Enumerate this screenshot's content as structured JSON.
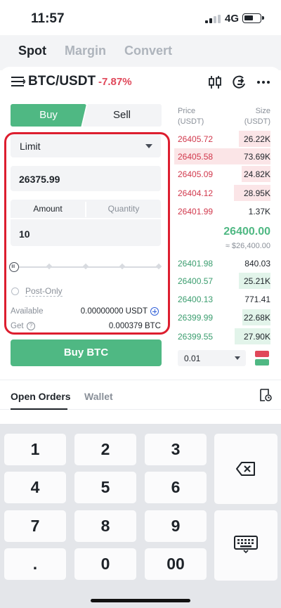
{
  "status": {
    "time": "11:57",
    "network": "4G"
  },
  "mode_tabs": [
    {
      "label": "Spot",
      "active": true
    },
    {
      "label": "Margin",
      "active": false
    },
    {
      "label": "Convert",
      "active": false
    }
  ],
  "pair": {
    "name": "BTC/USDT",
    "change": "-7.87%",
    "change_color": "#e0485a"
  },
  "form": {
    "buy_tab": "Buy",
    "sell_tab": "Sell",
    "order_type": "Limit",
    "price": "26375.99",
    "amount_tab": "Amount",
    "quantity_tab": "Quantity",
    "amount": "10",
    "slider_percent": 0,
    "post_only": "Post-Only",
    "available_label": "Available",
    "available_value": "0.00000000 USDT",
    "get_label": "Get",
    "get_value": "0.000379 BTC",
    "buy_button": "Buy BTC"
  },
  "orderbook": {
    "price_header": "Price",
    "price_unit": "(USDT)",
    "size_header": "Size",
    "size_unit": "(USDT)",
    "asks": [
      {
        "price": "26405.72",
        "size": "26.22K",
        "depth": 0.33
      },
      {
        "price": "26405.58",
        "size": "73.69K",
        "depth": 1.0
      },
      {
        "price": "26405.09",
        "size": "24.82K",
        "depth": 0.3
      },
      {
        "price": "26404.12",
        "size": "28.95K",
        "depth": 0.38
      },
      {
        "price": "26401.99",
        "size": "1.37K",
        "depth": 0.0
      }
    ],
    "mid_price": "26400.00",
    "mid_price_fiat": "≈ $26,400.00",
    "bids": [
      {
        "price": "26401.98",
        "size": "840.03",
        "depth": 0.0
      },
      {
        "price": "26400.57",
        "size": "25.21K",
        "depth": 0.33
      },
      {
        "price": "26400.13",
        "size": "771.41",
        "depth": 0.0
      },
      {
        "price": "26399.99",
        "size": "22.68K",
        "depth": 0.29
      },
      {
        "price": "26399.55",
        "size": "27.90K",
        "depth": 0.37
      }
    ],
    "tick_size": "0.01"
  },
  "bottom_tabs": [
    {
      "label": "Open Orders",
      "active": true
    },
    {
      "label": "Wallet",
      "active": false
    }
  ],
  "keypad": {
    "keys": [
      "1",
      "2",
      "3",
      "4",
      "5",
      "6",
      "7",
      "8",
      "9",
      ".",
      "0",
      "00"
    ],
    "backspace_icon": "backspace-icon",
    "keyboard_icon": "keyboard-icon"
  },
  "colors": {
    "buy_green": "#4fb883",
    "ask_red": "#d1384c",
    "bid_green": "#3a9d6e",
    "highlight_red": "#dd1e2f"
  }
}
